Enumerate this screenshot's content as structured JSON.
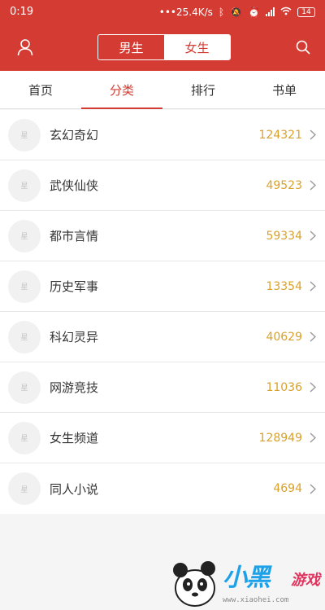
{
  "status_bar": {
    "time": "0:19",
    "network_speed": "•••25.4K/s",
    "battery": "14"
  },
  "header": {
    "tabs": [
      "男生",
      "女生"
    ],
    "active_gender": "女生"
  },
  "nav_tabs": [
    {
      "label": "首页"
    },
    {
      "label": "分类"
    },
    {
      "label": "排行"
    },
    {
      "label": "书单"
    }
  ],
  "active_nav": "分类",
  "categories": [
    {
      "name": "玄幻奇幻",
      "count": "124321"
    },
    {
      "name": "武侠仙侠",
      "count": "49523"
    },
    {
      "name": "都市言情",
      "count": "59334"
    },
    {
      "name": "历史军事",
      "count": "13354"
    },
    {
      "name": "科幻灵异",
      "count": "40629"
    },
    {
      "name": "网游竞技",
      "count": "11036"
    },
    {
      "name": "女生频道",
      "count": "128949"
    },
    {
      "name": "同人小说",
      "count": "4694"
    }
  ],
  "thumb_label": "星",
  "watermark": {
    "brand": "小黑",
    "brand2": "游戏",
    "url": "www.xiaohei.com"
  },
  "colors": {
    "primary": "#d43c33",
    "count": "#d9a12c",
    "link": "#1da1e8"
  }
}
